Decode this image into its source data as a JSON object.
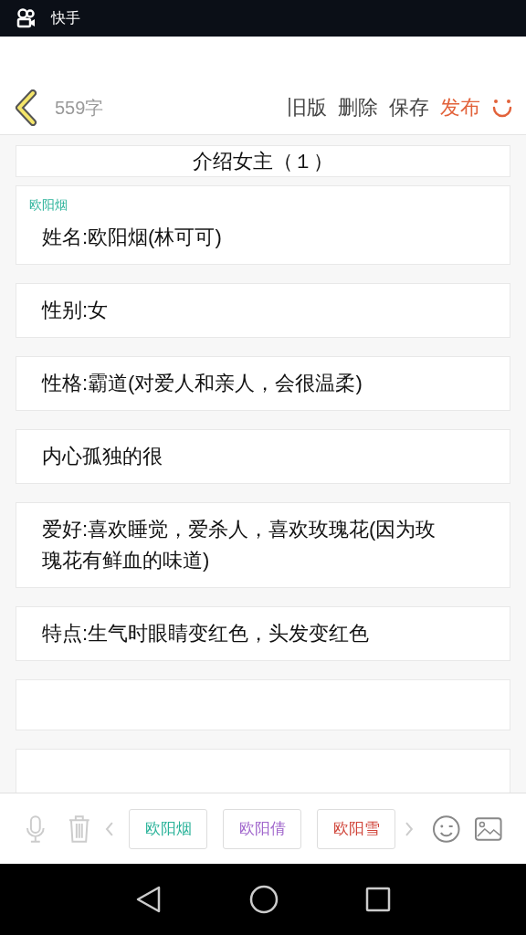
{
  "status_bar": {
    "app_name": "快手"
  },
  "header": {
    "word_count": "559字",
    "actions": [
      {
        "label": "旧版",
        "kind": "plain"
      },
      {
        "label": "删除",
        "kind": "plain"
      },
      {
        "label": "保存",
        "kind": "plain"
      },
      {
        "label": "发布",
        "kind": "primary"
      }
    ]
  },
  "title": "介绍女主（１）",
  "paragraphs": [
    {
      "kind": "text",
      "speaker": {
        "name": "欧阳烟",
        "color": "#2bb39a"
      },
      "text": "姓名:欧阳烟(林可可)"
    },
    {
      "kind": "text",
      "text": "性别:女"
    },
    {
      "kind": "text",
      "text": "性格:霸道(对爱人和亲人，会很温柔)"
    },
    {
      "kind": "text",
      "text": "内心孤独的很"
    },
    {
      "kind": "text",
      "text": "爱好:喜欢睡觉，爱杀人，喜欢玫瑰花(因为玫瑰花有鲜血的味道)"
    },
    {
      "kind": "text",
      "text": "特点:生气时眼睛变红色，头发变红色"
    },
    {
      "kind": "empty"
    },
    {
      "kind": "empty"
    }
  ],
  "characters": [
    {
      "name": "欧阳烟",
      "color": "#2bb39a"
    },
    {
      "name": "欧阳倩",
      "color": "#a066cc"
    },
    {
      "name": "欧阳雪",
      "color": "#d0453a"
    }
  ]
}
